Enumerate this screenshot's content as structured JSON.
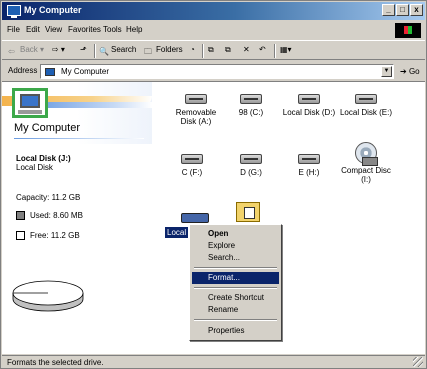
{
  "window": {
    "title": "My Computer",
    "minimize": "_",
    "maximize": "□",
    "close": "x"
  },
  "menubar": [
    "File",
    "Edit",
    "View",
    "Favorites",
    "Tools",
    "Help"
  ],
  "toolbar": {
    "back": "Back",
    "search": "Search",
    "folders": "Folders"
  },
  "address": {
    "label": "Address",
    "value": "My Computer",
    "go": "Go"
  },
  "left_pane": {
    "heading": "My Computer",
    "drive_title": "Local Disk (J:)",
    "drive_type": "Local Disk",
    "capacity": "Capacity: 11.2 GB",
    "used": "Used: 8.60 MB",
    "free": "Free: 11.2 GB",
    "used_fraction": 0.001,
    "used_color": "#808080",
    "free_color": "#ffffff"
  },
  "drives": [
    {
      "label": "Removable Disk (A:)",
      "icon": "floppy-drive-icon"
    },
    {
      "label": "98 (C:)",
      "icon": "hard-drive-icon"
    },
    {
      "label": "Local Disk (D:)",
      "icon": "hard-drive-icon"
    },
    {
      "label": "Local Disk (E:)",
      "icon": "hard-drive-icon"
    },
    {
      "label": "C (F:)",
      "icon": "hard-drive-icon"
    },
    {
      "label": "D (G:)",
      "icon": "hard-drive-icon"
    },
    {
      "label": "E (H:)",
      "icon": "hard-drive-icon"
    },
    {
      "label": "Compact Disc (I:)",
      "icon": "cd-drive-icon"
    }
  ],
  "selected_drive_label": "Local",
  "context_menu": {
    "open": "Open",
    "explore": "Explore",
    "search": "Search...",
    "format": "Format...",
    "create_shortcut": "Create Shortcut",
    "rename": "Rename",
    "properties": "Properties"
  },
  "status": "Formats the selected drive."
}
